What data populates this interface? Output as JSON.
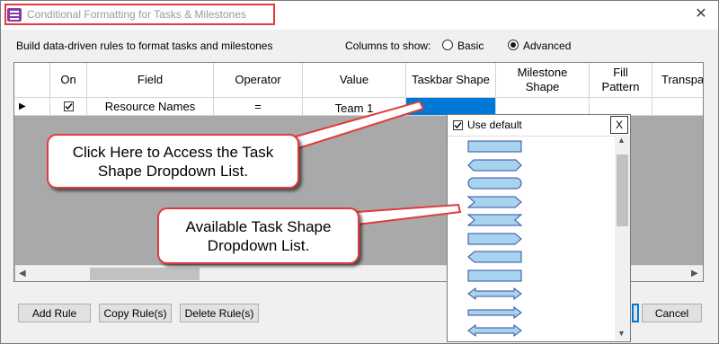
{
  "window": {
    "title": "Conditional Formatting for Tasks & Milestones",
    "close_glyph": "✕"
  },
  "description": "Build data-driven rules to format tasks and milestones",
  "columns_to_show": {
    "label": "Columns to show:",
    "options": [
      {
        "label": "Basic",
        "selected": false
      },
      {
        "label": "Advanced",
        "selected": true
      }
    ]
  },
  "grid": {
    "headers": {
      "on": "On",
      "field": "Field",
      "operator": "Operator",
      "value": "Value",
      "taskbar_shape": "Taskbar Shape",
      "milestone_shape": "Milestone Shape",
      "fill_pattern": "Fill Pattern",
      "transparency": "Transpa %"
    },
    "rows": [
      {
        "on": true,
        "field": "Resource Names",
        "operator": "=",
        "value": "Team 1"
      }
    ],
    "row_pointer_glyph": "▶"
  },
  "dropdown": {
    "use_default_label": "Use default",
    "use_default_checked": true,
    "close_label": "X",
    "shapes": [
      "rectangle-bar-icon",
      "hexagon-bar-icon",
      "rounded-bar-icon",
      "chevron-bar-icon",
      "ribbon-bar-icon",
      "arrow-right-bar-icon",
      "notched-bar-icon",
      "rectangle-thin-bar-icon",
      "double-arrow-bar-icon",
      "arrow-head-bar-icon",
      "double-arrow-thin-bar-icon"
    ],
    "shape_fill": "#a7d3ee",
    "shape_stroke": "#2f4fa4"
  },
  "callouts": {
    "task_shape": "Click Here to Access the Task Shape Dropdown List.",
    "available": "Available Task Shape Dropdown List."
  },
  "buttons": {
    "add_rule": "Add Rule",
    "copy_rule": "Copy Rule(s)",
    "delete_rule": "Delete Rule(s)",
    "cancel": "Cancel"
  },
  "colors": {
    "accent": "#0078d7",
    "highlight_border": "#e23a3a",
    "grid_empty": "#a9a9a9"
  }
}
